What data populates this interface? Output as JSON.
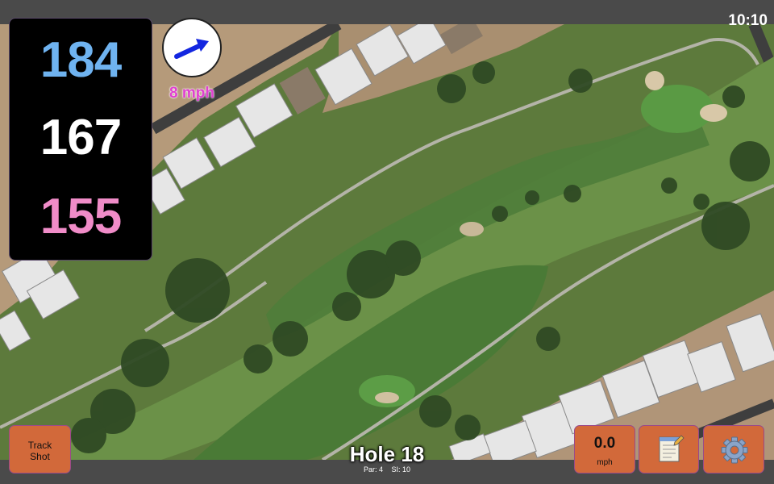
{
  "status": {
    "time": "10:10"
  },
  "distances": {
    "back": "184",
    "center": "167",
    "front": "155"
  },
  "wind": {
    "speed": "8 mph",
    "icon": "wind-direction-arrow-icon"
  },
  "buttons": {
    "track_line1": "Track",
    "track_line2": "Shot",
    "speed_value": "0.0",
    "speed_unit": "mph",
    "notes_icon": "notepad-icon",
    "settings_icon": "gear-icon"
  },
  "hole": {
    "title": "Hole 18",
    "par": "Par: 4",
    "si": "SI: 10"
  },
  "colors": {
    "back": "#6fb3f0",
    "center": "#ffffff",
    "front": "#f08cc8",
    "wind_text": "#e040d0",
    "button": "#d2693a"
  }
}
